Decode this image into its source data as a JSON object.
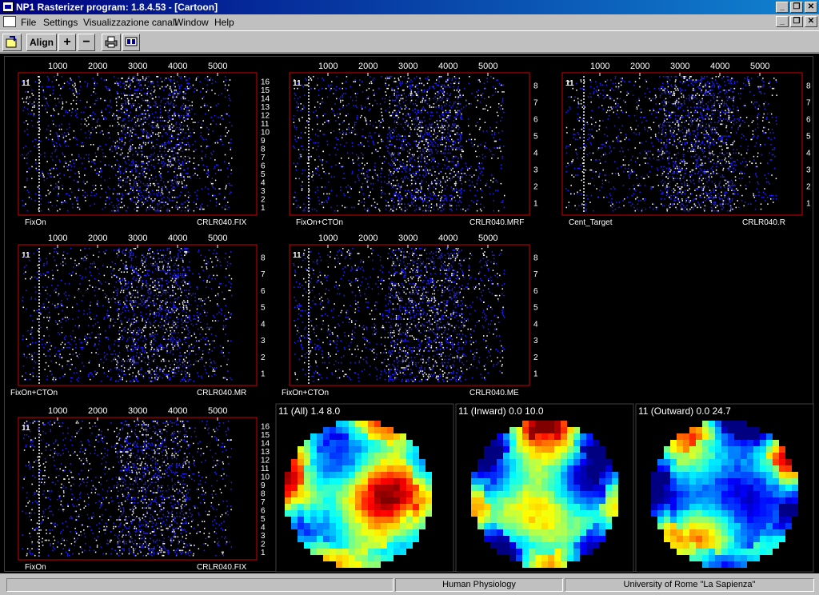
{
  "window": {
    "title": "NP1 Rasterizer program: 1.8.4.53 - [Cartoon]",
    "minimize": "_",
    "restore": "❐",
    "close": "✕"
  },
  "menu": {
    "items": [
      "File",
      "Settings",
      "Visualizzazione canali",
      "Window",
      "Help"
    ]
  },
  "toolbar": {
    "align_label": "Align",
    "plus_label": "+",
    "minus_label": "−"
  },
  "axis_ticks": [
    "1000",
    "2000",
    "3000",
    "4000",
    "5000"
  ],
  "channel_id": "11",
  "rasters": [
    {
      "id": "r1",
      "event": "FixOn",
      "file": "CRLR040.FIX",
      "rows": [
        "16",
        "15",
        "14",
        "13",
        "12",
        "11",
        "10",
        "9",
        "8",
        "7",
        "6",
        "5",
        "4",
        "3",
        "2",
        "1"
      ]
    },
    {
      "id": "r2",
      "event": "FixOn+CTOn",
      "file": "CRLR040.MRF",
      "rows": [
        "8",
        "7",
        "6",
        "5",
        "4",
        "3",
        "2",
        "1"
      ]
    },
    {
      "id": "r3",
      "event": "Cent_Target",
      "file": "CRLR040.R",
      "rows": [
        "8",
        "7",
        "6",
        "5",
        "4",
        "3",
        "2",
        "1"
      ]
    },
    {
      "id": "r4",
      "event": "FixOn+CTOn",
      "file": "CRLR040.MR",
      "rows": [
        "8",
        "7",
        "6",
        "5",
        "4",
        "3",
        "2",
        "1"
      ]
    },
    {
      "id": "r5",
      "event": "FixOn+CTOn",
      "file": "CRLR040.ME",
      "rows": [
        "8",
        "7",
        "6",
        "5",
        "4",
        "3",
        "2",
        "1"
      ]
    },
    {
      "id": "r6",
      "event": "FixOn",
      "file": "CRLR040.FIX",
      "rows": [
        "16",
        "15",
        "14",
        "13",
        "12",
        "11",
        "10",
        "9",
        "8",
        "7",
        "6",
        "5",
        "4",
        "3",
        "2",
        "1"
      ]
    }
  ],
  "maps": [
    {
      "id": "m1",
      "label": "11 (All)  1.4  8.0"
    },
    {
      "id": "m2",
      "label": "11 (Inward)  0.0  10.0"
    },
    {
      "id": "m3",
      "label": "11 (Outward)  0.0  24.7"
    }
  ],
  "status": {
    "cell1": "",
    "cell2": "Human Physiology",
    "cell3": "University of Rome \"La Sapienza\""
  },
  "colors": {
    "frame_red": "#d00000",
    "spike_white": "#ffffff",
    "spike_blue": "#2020ff",
    "titlebar": "#000080"
  }
}
